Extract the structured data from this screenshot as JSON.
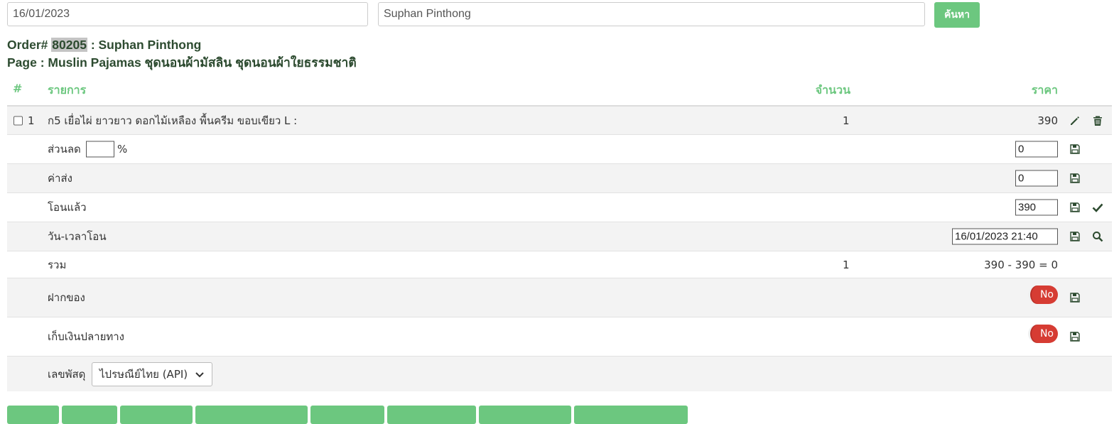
{
  "search": {
    "date_value": "16/01/2023",
    "name_value": "Suphan Pinthong",
    "button_label": "ค้นหา"
  },
  "order": {
    "prefix": "Order#",
    "number": "80205",
    "customer": ": Suphan Pinthong",
    "page_line": "Page : Muslin Pajamas ชุดนอนผ้ามัสลิน ชุดนอนผ้าใยธรรมชาติ"
  },
  "table": {
    "headers": {
      "num": "#",
      "item": "รายการ",
      "qty": "จำนวน",
      "price": "ราคา"
    },
    "item": {
      "index": "1",
      "name": "ก5 เยื่อไผ่ ยาวยาว ดอกไม้เหลือง พื้นครีม ขอบเขียว L :",
      "qty": "1",
      "price": "390"
    },
    "discount": {
      "label": "ส่วนลด",
      "percent_value": "",
      "percent_sign": "%",
      "value": "0"
    },
    "shipping": {
      "label": "ค่าส่ง",
      "value": "0"
    },
    "transferred": {
      "label": "โอนแล้ว",
      "value": "390"
    },
    "transfer_time": {
      "label": "วัน-เวลาโอน",
      "value": "16/01/2023 21:40"
    },
    "total": {
      "label": "รวม",
      "qty": "1",
      "formula": "390 - 390 = 0"
    },
    "deposit": {
      "label": "ฝากของ",
      "toggle": "No"
    },
    "cod": {
      "label": "เก็บเงินปลายทาง",
      "toggle": "No"
    },
    "tracking": {
      "label": "เลขพัสดุ",
      "carrier": "ไปรษณีย์ไทย (API)"
    }
  },
  "colors": {
    "accent_green": "#6cc77f",
    "toggle_red": "#d63c33",
    "title_green": "#2d4b30"
  },
  "icons": [
    "pencil-icon",
    "trash-icon",
    "save-icon",
    "check-icon",
    "search-icon",
    "chevron-down-icon"
  ]
}
